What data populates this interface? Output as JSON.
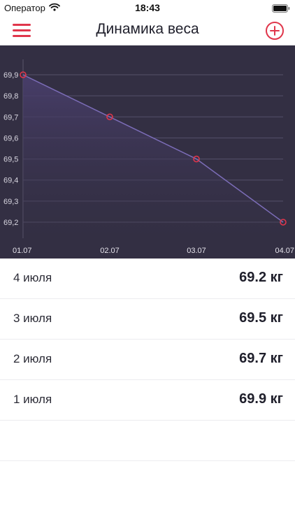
{
  "status_bar": {
    "carrier": "Оператор",
    "time": "18:43"
  },
  "header": {
    "title": "Динамика веса",
    "menu_icon": "hamburger-menu-icon",
    "add_icon": "plus-circle-icon"
  },
  "colors": {
    "accent": "#e0364b",
    "chart_background": "#332f43",
    "chart_line": "#7c6db8"
  },
  "chart_data": {
    "type": "area",
    "categories": [
      "01.07",
      "02.07",
      "03.07",
      "04.07"
    ],
    "values": [
      69.9,
      69.7,
      69.5,
      69.2
    ],
    "y_ticks": [
      "69,9",
      "69,8",
      "69,7",
      "69,6",
      "69,5",
      "69,4",
      "69,3",
      "69,2"
    ],
    "ylim": [
      69.2,
      69.9
    ],
    "grid": true
  },
  "entries": [
    {
      "date": "4 июля",
      "weight": "69.2 кг"
    },
    {
      "date": "3 июля",
      "weight": "69.5 кг"
    },
    {
      "date": "2 июля",
      "weight": "69.7 кг"
    },
    {
      "date": "1 июля",
      "weight": "69.9 кг"
    }
  ]
}
